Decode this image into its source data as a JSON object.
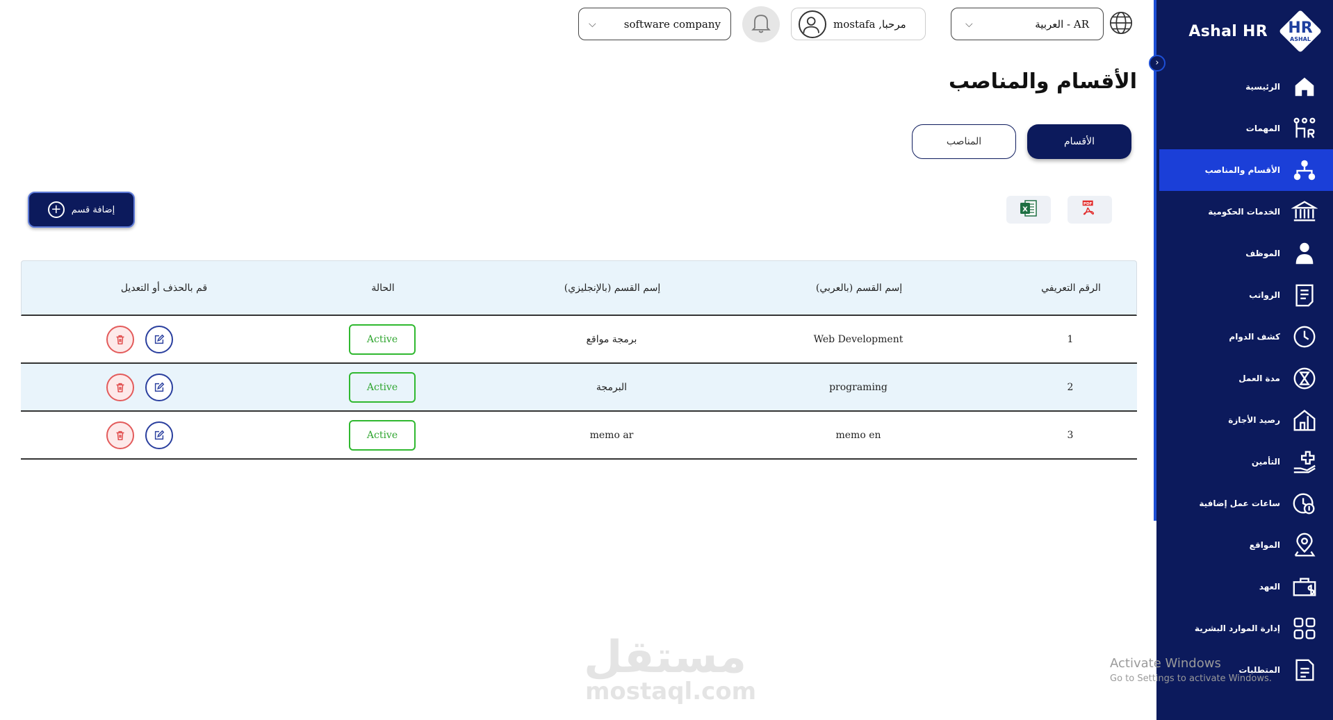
{
  "sidebar": {
    "brand": "Ashal HR",
    "logo_mark": "HR",
    "logo_sub": "ASHAL",
    "items": [
      {
        "label": "الرئيسية",
        "icon": "home-icon",
        "active": false
      },
      {
        "label": "المهمات",
        "icon": "tasks-icon",
        "active": false
      },
      {
        "label": "الأقسام والمناصب",
        "icon": "org-chart-icon",
        "active": true
      },
      {
        "label": "الخدمات الحكومية",
        "icon": "government-building-icon",
        "active": false
      },
      {
        "label": "الموظف",
        "icon": "user-icon",
        "active": false
      },
      {
        "label": "الرواتب",
        "icon": "payroll-icon",
        "active": false
      },
      {
        "label": "كشف الدوام",
        "icon": "clock-icon",
        "active": false
      },
      {
        "label": "مدة العمل",
        "icon": "hourglass-icon",
        "active": false
      },
      {
        "label": "رصيد الأجازة",
        "icon": "vacation-house-icon",
        "active": false
      },
      {
        "label": "التأمين",
        "icon": "insurance-hand-icon",
        "active": false
      },
      {
        "label": "ساعات عمل إضافية",
        "icon": "overtime-clock-icon",
        "active": false
      },
      {
        "label": "المواقع",
        "icon": "location-pin-icon",
        "active": false
      },
      {
        "label": "العهد",
        "icon": "briefcase-money-icon",
        "active": false
      },
      {
        "label": "إدارة الموارد البشرية",
        "icon": "grid-icon",
        "active": false
      },
      {
        "label": "المتطلبات",
        "icon": "requirements-doc-icon",
        "active": false
      }
    ],
    "colors": {
      "background": "#0c1a5c",
      "active": "#1b3fd8"
    }
  },
  "header": {
    "language": "العربية - AR",
    "greeting": "مرحبا, mostafa",
    "company": "software company"
  },
  "main": {
    "title": "الأقسام والمناصب",
    "tabs": {
      "departments": "الأقسام",
      "positions": "المناصب"
    },
    "add_button": "إضافة قسم",
    "export": {
      "pdf": "PDF",
      "excel": "X"
    }
  },
  "table": {
    "headers": {
      "id": "الرقم التعريفي",
      "name_ar": "إسم القسم (بالعربي)",
      "name_en": "إسم القسم (بالإنجليزي)",
      "status": "الحالة",
      "actions": "قم بالحذف أو التعديل"
    },
    "rows": [
      {
        "id": "1",
        "name_ar": "Web Development",
        "name_en": "برمجة مواقع",
        "status": "Active"
      },
      {
        "id": "2",
        "name_ar": "programing",
        "name_en": "البرمجة",
        "status": "Active"
      },
      {
        "id": "3",
        "name_ar": "memo en",
        "name_en": "memo ar",
        "status": "Active"
      }
    ]
  },
  "watermark": {
    "arabic": "مستقل",
    "latin": "mostaql.com"
  },
  "windows_notice": {
    "title": "Activate Windows",
    "subtitle": "Go to Settings to activate Windows."
  }
}
